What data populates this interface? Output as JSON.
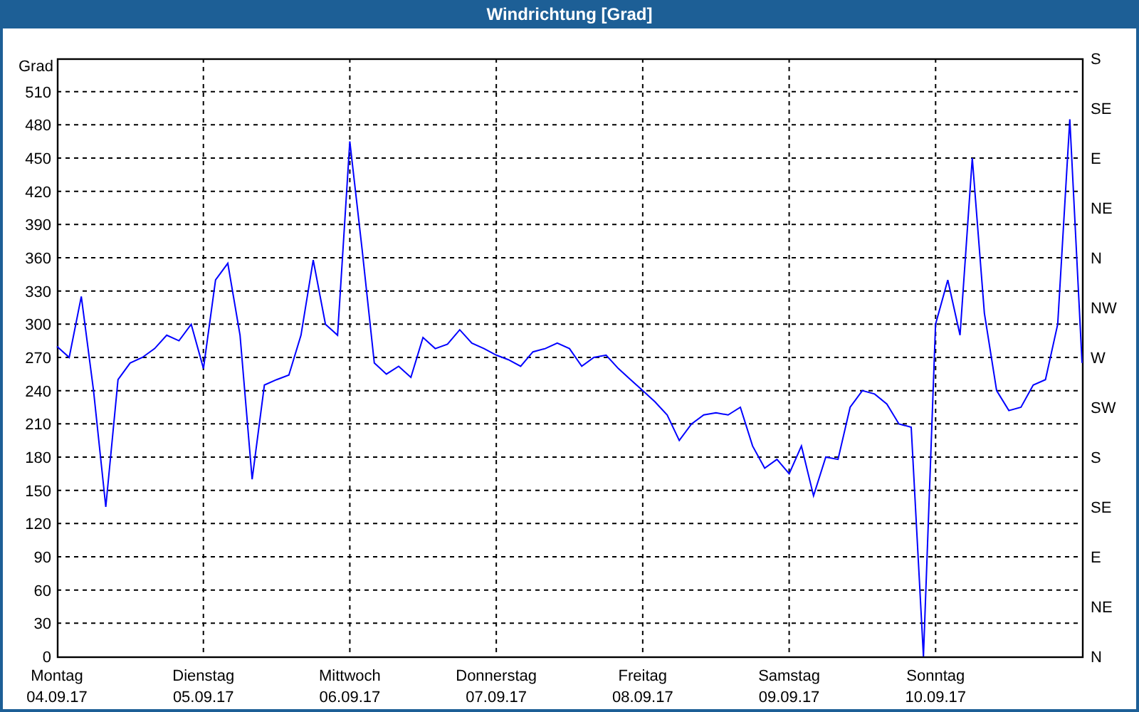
{
  "window": {
    "title": "Windrichtung [Grad]"
  },
  "chart": {
    "chart_data": {
      "type": "line",
      "grid": true,
      "ylabel": "Grad",
      "ylim": [
        0,
        540
      ],
      "yticks": [
        0,
        30,
        60,
        90,
        120,
        150,
        180,
        210,
        240,
        270,
        300,
        330,
        360,
        390,
        420,
        450,
        480,
        510
      ],
      "categories": [
        "Montag",
        null,
        null,
        null,
        null,
        null,
        null,
        null,
        null,
        null,
        null,
        null,
        "Dienstag",
        null,
        null,
        null,
        null,
        null,
        null,
        null,
        null,
        null,
        null,
        null,
        "Mittwoch",
        null,
        null,
        null,
        null,
        null,
        null,
        null,
        null,
        null,
        null,
        null,
        "Donnerstag",
        null,
        null,
        null,
        null,
        null,
        null,
        null,
        null,
        null,
        null,
        null,
        "Freitag",
        null,
        null,
        null,
        null,
        null,
        null,
        null,
        null,
        null,
        null,
        null,
        "Samstag",
        null,
        null,
        null,
        null,
        null,
        null,
        null,
        null,
        null,
        null,
        null,
        "Sonntag",
        null,
        null,
        null,
        null,
        null,
        null,
        null,
        null,
        null,
        null,
        null,
        null
      ],
      "series": [
        {
          "color": "#0000ff",
          "values": [
            280,
            270,
            325,
            240,
            135,
            250,
            265,
            270,
            278,
            290,
            285,
            300,
            260,
            340,
            355,
            290,
            160,
            245,
            250,
            254,
            290,
            358,
            300,
            290,
            465,
            368,
            265,
            255,
            262,
            252,
            288,
            278,
            282,
            295,
            283,
            278,
            272,
            268,
            262,
            275,
            278,
            283,
            278,
            262,
            270,
            272,
            260,
            250,
            240,
            230,
            218,
            195,
            210,
            218,
            220,
            218,
            225,
            190,
            170,
            178,
            165,
            190,
            145,
            180,
            178,
            225,
            240,
            237,
            228,
            210,
            207,
            0,
            300,
            340,
            290,
            450,
            310,
            240,
            222,
            225,
            245,
            250,
            300,
            485,
            265
          ]
        }
      ]
    },
    "x_dates": [
      "04.09.17",
      "05.09.17",
      "06.09.17",
      "07.09.17",
      "08.09.17",
      "09.09.17",
      "10.09.17"
    ],
    "right_axis_labels": [
      "S",
      "SE",
      "E",
      "NE",
      "N",
      "NW",
      "W",
      "SW",
      "S",
      "SE",
      "E",
      "NE",
      "N"
    ]
  }
}
